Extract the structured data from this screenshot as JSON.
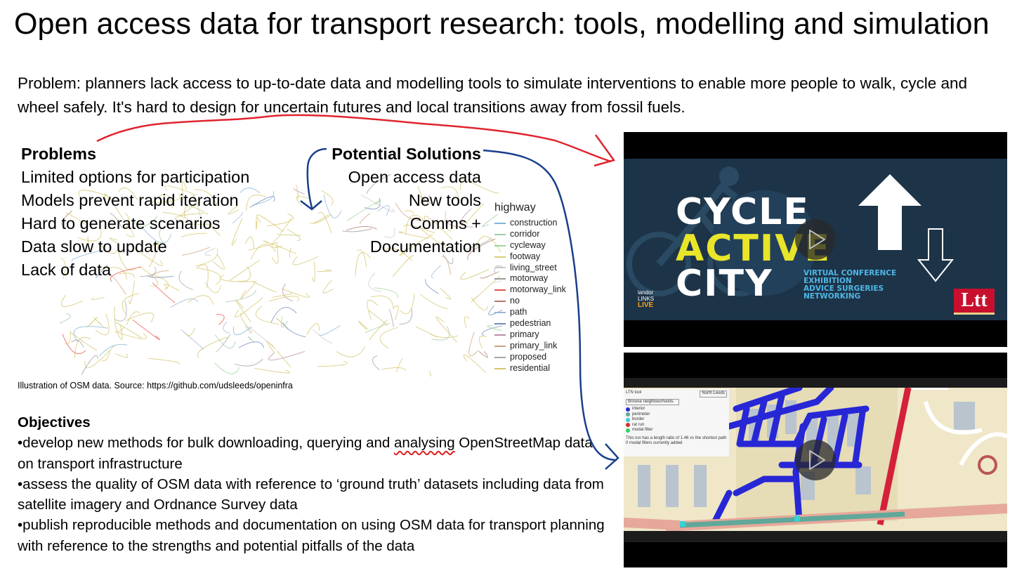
{
  "slide": {
    "title": "Open access data for transport research: tools, modelling and simulation",
    "problem_statement": "Problem: planners lack access to up-to-date data and modelling tools to simulate interventions to enable more people to walk, cycle and wheel safely. It's hard to design for uncertain futures and local transitions away from fossil fuels."
  },
  "problems": {
    "heading": "Problems",
    "items": [
      "Limited options for participation",
      "Models prevent rapid iteration",
      "Hard to generate scenarios",
      "Data slow to update",
      "Lack of data"
    ]
  },
  "solutions": {
    "heading": "Potential Solutions",
    "items": [
      "Open access data",
      "New tools",
      "Comms +",
      "Documentation"
    ]
  },
  "legend": {
    "title": "highway",
    "items": [
      {
        "label": "construction",
        "color": "#7fb3d5"
      },
      {
        "label": "corridor",
        "color": "#a3c9a8"
      },
      {
        "label": "cycleway",
        "color": "#9fd39a"
      },
      {
        "label": "footway",
        "color": "#d6cf7a"
      },
      {
        "label": "living_street",
        "color": "#c9c9c9"
      },
      {
        "label": "motorway",
        "color": "#999999"
      },
      {
        "label": "motorway_link",
        "color": "#e5534b"
      },
      {
        "label": "no",
        "color": "#b07a6e"
      },
      {
        "label": "path",
        "color": "#9ab6d8"
      },
      {
        "label": "pedestrian",
        "color": "#6f89b8"
      },
      {
        "label": "primary",
        "color": "#b98fa6"
      },
      {
        "label": "primary_link",
        "color": "#c9a27c"
      },
      {
        "label": "proposed",
        "color": "#a7a7a7"
      },
      {
        "label": "residential",
        "color": "#d4c46a"
      }
    ]
  },
  "caption": "Illustration of OSM data. Source:  https://github.com/udsleeds/openinfra",
  "objectives": {
    "heading": "Objectives",
    "item1_a": "•develop new methods for bulk downloading, querying and ",
    "item1_b": "analysing",
    "item1_c": " OpenStreetMap data on transport infrastructure",
    "item2": "•assess the quality of OSM data with reference to ‘ground truth’ datasets including data from satellite imagery and Ordnance Survey data",
    "item3": "•publish reproducible methods and documentation on using OSM data for transport planning with reference to the strengths and potential pitfalls of the data"
  },
  "video1": {
    "line1": "CYCLE",
    "line2": "ACTIVE",
    "line3": "CITY",
    "event_lines": [
      "VIRTUAL CONFERENCE",
      "EXHIBITION",
      "ADVICE SURGERIES",
      "NETWORKING"
    ],
    "logo_left_lines": [
      "landor",
      "LINKS",
      "LIVE"
    ],
    "logo_right": "Ltt",
    "bg_color": "#1d3448",
    "accent_yellow": "#e8e52a",
    "accent_blue": "#4fb6e6"
  },
  "video2": {
    "panel_title": "LTN tool",
    "panel_button": "North Leeds",
    "panel_browse": "Browse neighbourhoods",
    "panel_legend": [
      {
        "label": "interior",
        "color": "#2b2bd6"
      },
      {
        "label": "perimeter",
        "color": "#5fa89a"
      },
      {
        "label": "border",
        "color": "#3ad0d6"
      },
      {
        "label": "rat run",
        "color": "#d62b2b"
      },
      {
        "label": "modal filter",
        "color": "#2bd65a"
      }
    ],
    "panel_note": "This run has a length ratio of 1.46 vs the shortest path",
    "panel_note2": "0 modal filters currently added"
  }
}
